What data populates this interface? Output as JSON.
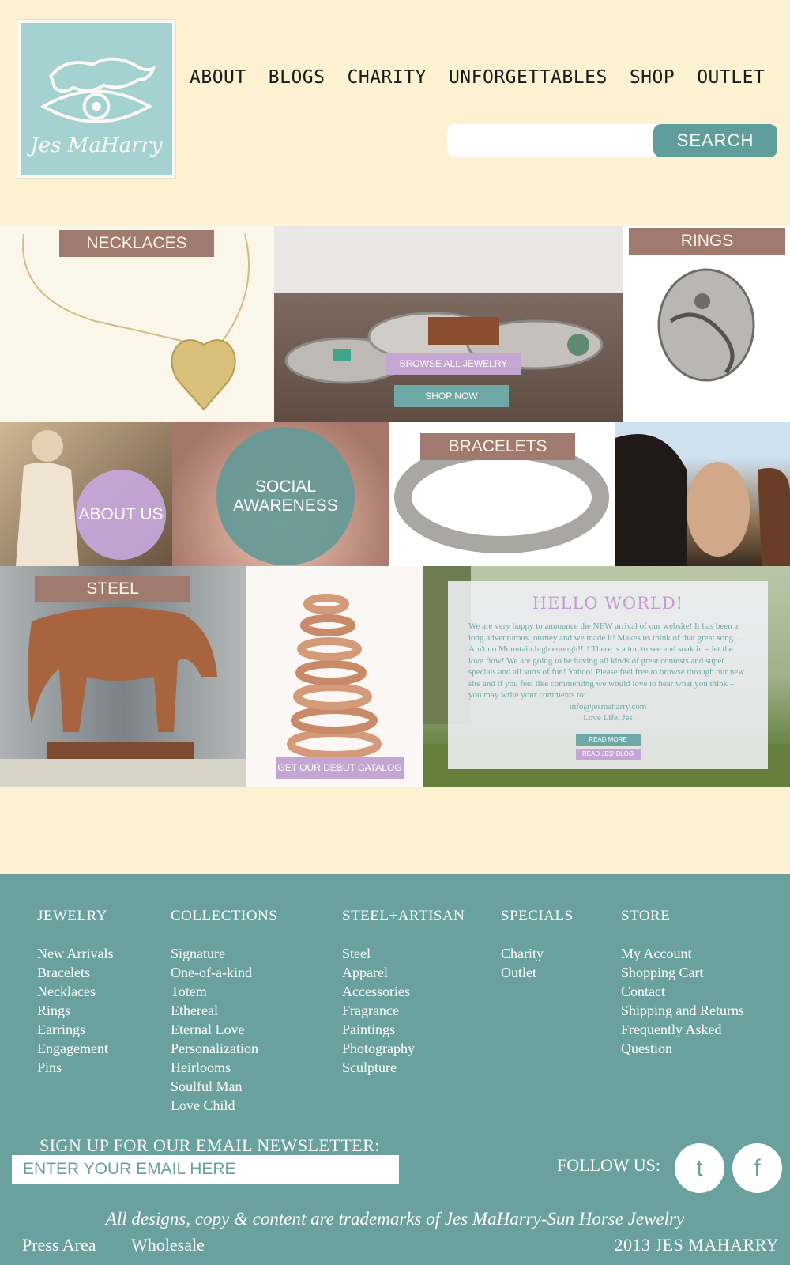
{
  "header": {
    "logo_text": "Jes MaHarry",
    "nav": [
      "ABOUT",
      "BLOGS",
      "CHARITY",
      "UNFORGETTABLES",
      "SHOP",
      "OUTLET"
    ],
    "search_button": "SEARCH",
    "search_placeholder": ""
  },
  "tiles": {
    "necklaces": "NECKLACES",
    "rings": "RINGS",
    "browse_all": "BROWSE ALL JEWELRY",
    "shop_now": "SHOP NOW",
    "about_us": "ABOUT US",
    "social_awareness": "SOCIAL AWARENESS",
    "bracelets": "BRACELETS",
    "steel": "STEEL",
    "catalog": "GET OUR DEBUT CATALOG"
  },
  "hello": {
    "title": "HELLO WORLD!",
    "body": "We are very happy to announce the NEW arrival of our website! It has been a long adventurous journey and we made it! Makes us think of that great song…Ain't no Mountain high enough!!!! There is a ton to see and soak in – let the love flow! We are going to be having all kinds of great contests and super specials and all sorts of fun! Yahoo! Please feel free to browse through our new site and if you feel like commenting we would love to hear what you think – you may write your comments to:",
    "email": "info@jesmaharry.com",
    "signoff": "Love Life, Jes",
    "read_more": "READ MORE",
    "read_blog": "READ JES' BLOG"
  },
  "footer": {
    "columns": [
      {
        "title": "JEWELRY",
        "items": [
          "New Arrivals",
          "Bracelets",
          "Necklaces",
          "Rings",
          "Earrings",
          "Engagement",
          "Pins"
        ]
      },
      {
        "title": "COLLECTIONS",
        "items": [
          "Signature",
          "One-of-a-kind",
          "Totem",
          "Ethereal",
          "Eternal Love",
          "Personalization",
          "Heirlooms",
          "Soulful Man",
          "Love Child"
        ]
      },
      {
        "title": "STEEL+ARTISAN",
        "items": [
          "Steel",
          "Apparel",
          "Accessories",
          "Fragrance",
          "Paintings",
          "Photography",
          "Sculpture"
        ]
      },
      {
        "title": "SPECIALS",
        "items": [
          "Charity",
          "Outlet"
        ]
      },
      {
        "title": "STORE",
        "items": [
          "My Account",
          "Shopping Cart",
          "Contact",
          "Shipping and Returns",
          "Frequently Asked",
          "Question"
        ]
      }
    ],
    "newsletter_title": "SIGN UP FOR OUR EMAIL NEWSLETTER:",
    "newsletter_placeholder": "ENTER YOUR EMAIL HERE",
    "follow_us": "FOLLOW US:",
    "twitter": "t",
    "facebook": "f",
    "trademark": "All designs, copy & content are trademarks of Jes MaHarry-Sun Horse Jewelry",
    "press": "Press Area",
    "wholesale": "Wholesale",
    "copyright": "2013 JES MAHARRY"
  },
  "colors": {
    "background": "#fcf2d2",
    "teal": "#6aa19f",
    "label_brown": "#a07a6e",
    "purple": "#c5a6d3"
  }
}
